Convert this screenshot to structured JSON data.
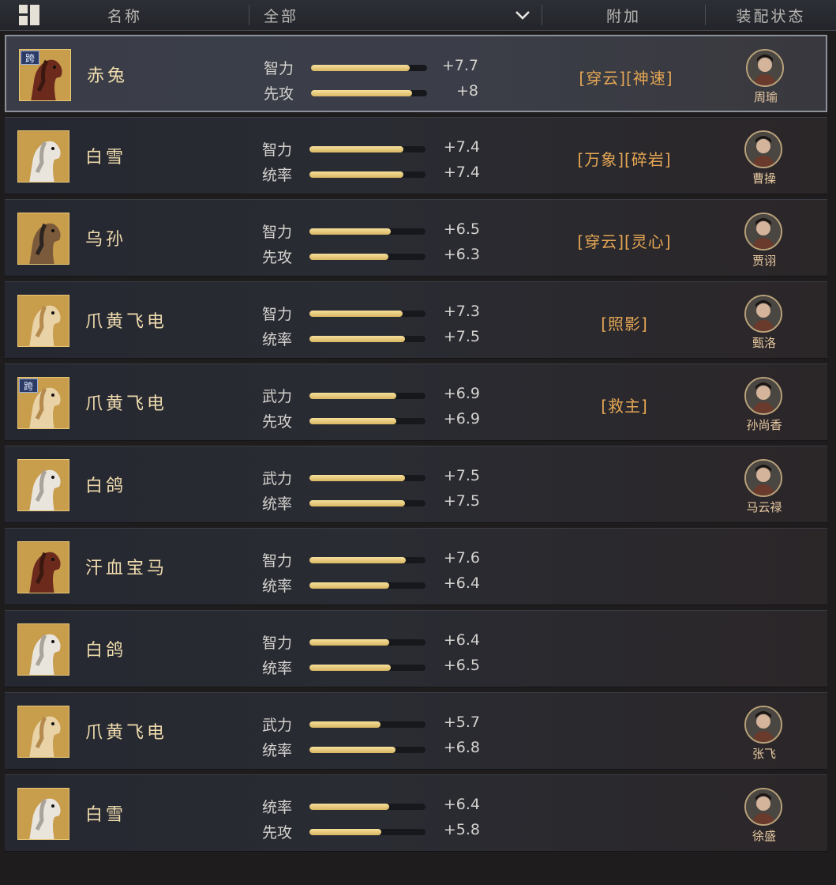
{
  "header": {
    "name_label": "名称",
    "filter_label": "全部",
    "bonus_label": "附加",
    "status_label": "装配状态"
  },
  "colors": {
    "accent": "#e4a654",
    "bar": "#e8cc7a",
    "name": "#f0dcae"
  },
  "rows": [
    {
      "name": "赤兔",
      "kua": "跨",
      "selected": true,
      "horse": "red-horse-icon",
      "stats": [
        {
          "label": "智力",
          "value": "+7.7",
          "fill": 0.85
        },
        {
          "label": "先攻",
          "value": "+8",
          "fill": 0.87
        }
      ],
      "bonus": "[穿云][神速]",
      "general": "周瑜"
    },
    {
      "name": "白雪",
      "kua": "",
      "selected": false,
      "horse": "white-horse-icon",
      "stats": [
        {
          "label": "智力",
          "value": "+7.4",
          "fill": 0.81
        },
        {
          "label": "统率",
          "value": "+7.4",
          "fill": 0.81
        }
      ],
      "bonus": "[万象][碎岩]",
      "general": "曹操"
    },
    {
      "name": "乌孙",
      "kua": "",
      "selected": false,
      "horse": "armored-horse-icon",
      "stats": [
        {
          "label": "智力",
          "value": "+6.5",
          "fill": 0.7
        },
        {
          "label": "先攻",
          "value": "+6.3",
          "fill": 0.68
        }
      ],
      "bonus": "[穿云][灵心]",
      "general": "贾诩"
    },
    {
      "name": "爪黄飞电",
      "kua": "",
      "selected": false,
      "horse": "palomino-horse-icon",
      "stats": [
        {
          "label": "智力",
          "value": "+7.3",
          "fill": 0.8
        },
        {
          "label": "统率",
          "value": "+7.5",
          "fill": 0.82
        }
      ],
      "bonus": "[照影]",
      "general": "甄洛"
    },
    {
      "name": "爪黄飞电",
      "kua": "跨",
      "selected": false,
      "horse": "palomino-horse-icon",
      "stats": [
        {
          "label": "武力",
          "value": "+6.9",
          "fill": 0.75
        },
        {
          "label": "先攻",
          "value": "+6.9",
          "fill": 0.75
        }
      ],
      "bonus": "[救主]",
      "general": "孙尚香"
    },
    {
      "name": "白鸽",
      "kua": "",
      "selected": false,
      "horse": "white-horse-icon",
      "stats": [
        {
          "label": "武力",
          "value": "+7.5",
          "fill": 0.82
        },
        {
          "label": "统率",
          "value": "+7.5",
          "fill": 0.82
        }
      ],
      "bonus": "",
      "general": "马云禄"
    },
    {
      "name": "汗血宝马",
      "kua": "",
      "selected": false,
      "horse": "red-horse-icon",
      "stats": [
        {
          "label": "智力",
          "value": "+7.6",
          "fill": 0.83
        },
        {
          "label": "统率",
          "value": "+6.4",
          "fill": 0.69
        }
      ],
      "bonus": "",
      "general": ""
    },
    {
      "name": "白鸽",
      "kua": "",
      "selected": false,
      "horse": "white-horse-icon",
      "stats": [
        {
          "label": "智力",
          "value": "+6.4",
          "fill": 0.69
        },
        {
          "label": "统率",
          "value": "+6.5",
          "fill": 0.7
        }
      ],
      "bonus": "",
      "general": ""
    },
    {
      "name": "爪黄飞电",
      "kua": "",
      "selected": false,
      "horse": "palomino-horse-icon",
      "stats": [
        {
          "label": "武力",
          "value": "+5.7",
          "fill": 0.61
        },
        {
          "label": "统率",
          "value": "+6.8",
          "fill": 0.74
        }
      ],
      "bonus": "",
      "general": "张飞"
    },
    {
      "name": "白雪",
      "kua": "",
      "selected": false,
      "horse": "white-horse-icon",
      "stats": [
        {
          "label": "统率",
          "value": "+6.4",
          "fill": 0.69
        },
        {
          "label": "先攻",
          "value": "+5.8",
          "fill": 0.62
        }
      ],
      "bonus": "",
      "general": "徐盛"
    }
  ]
}
